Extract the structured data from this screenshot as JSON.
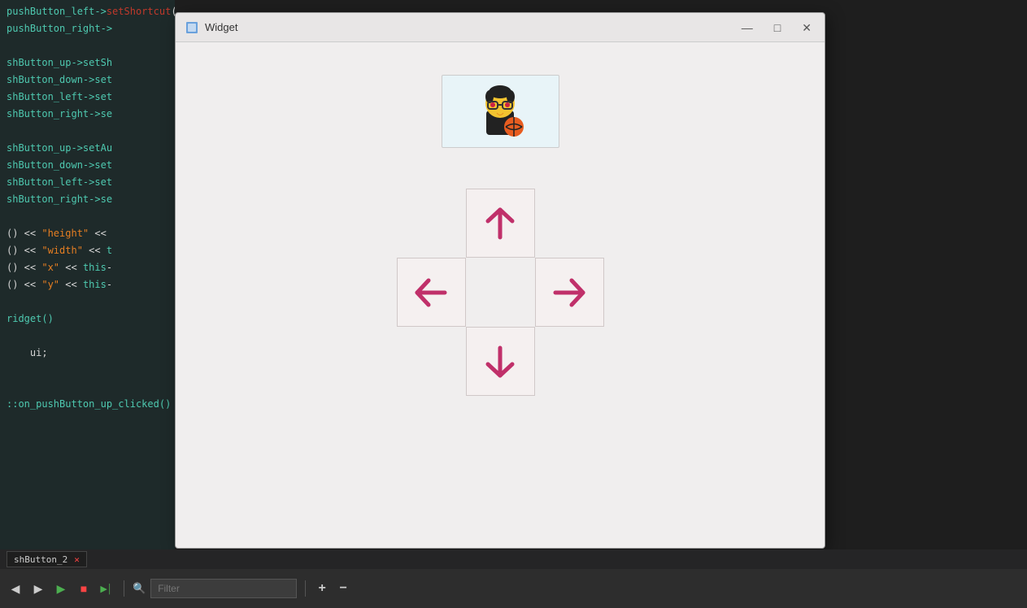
{
  "window": {
    "title": "Widget",
    "icon": "□"
  },
  "code_lines": [
    {
      "text": "pushButton_left->setShortcut(QKeySequence(\"a\"));",
      "color": "mixed1"
    },
    {
      "text": "pushButton_right->",
      "color": "mixed2"
    },
    {
      "text": "",
      "color": ""
    },
    {
      "text": "shButton_up->setSh",
      "color": "mixed3"
    },
    {
      "text": "shButton_down->set",
      "color": "mixed3"
    },
    {
      "text": "shButton_left->set",
      "color": "mixed3"
    },
    {
      "text": "shButton_right->se",
      "color": "mixed3"
    },
    {
      "text": "",
      "color": ""
    },
    {
      "text": "shButton_up->setAu",
      "color": "mixed4"
    },
    {
      "text": "shButton_down->set",
      "color": "mixed4"
    },
    {
      "text": "shButton_left->set",
      "color": "mixed4"
    },
    {
      "text": "shButton_right->se",
      "color": "mixed4"
    },
    {
      "text": "",
      "color": ""
    },
    {
      "text": "() << \"height\" <<",
      "color": "mixed5"
    },
    {
      "text": "() << \"width\" << t",
      "color": "mixed5"
    },
    {
      "text": "() << \"x\" << this-",
      "color": "mixed5"
    },
    {
      "text": "() << \"y\" << this-",
      "color": "mixed5"
    },
    {
      "text": "",
      "color": ""
    },
    {
      "text": "ridget()",
      "color": "mixed6"
    },
    {
      "text": "",
      "color": ""
    },
    {
      "text": "    ui;",
      "color": "white"
    },
    {
      "text": "",
      "color": ""
    },
    {
      "text": "",
      "color": ""
    },
    {
      "text": "::on_pushButton_up_clicked()",
      "color": "mixed7"
    }
  ],
  "toolbar": {
    "filter_placeholder": "Filter",
    "plus_label": "+",
    "minus_label": "−"
  },
  "bottom_tab": {
    "label": "shButton_2",
    "close": "✕"
  },
  "arrows": {
    "up": "↑",
    "down": "↓",
    "left": "←",
    "right": "→"
  },
  "colors": {
    "arrow_color": "#c0306a",
    "window_bg": "#f0eeee",
    "code_bg": "#1e2a2a"
  }
}
